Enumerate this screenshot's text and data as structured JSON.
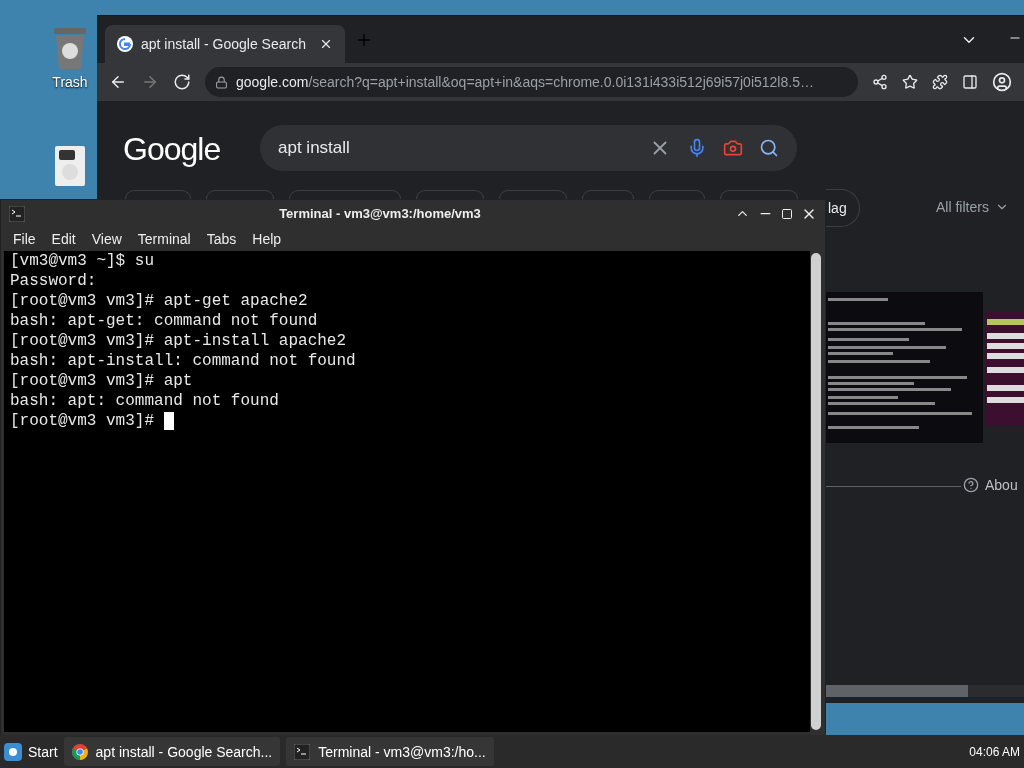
{
  "desktop": {
    "icons": [
      {
        "label": "Trash"
      }
    ]
  },
  "browser": {
    "tab": {
      "title": "apt install - Google Search",
      "selected": true
    },
    "address": {
      "host": "google.com",
      "path": "/search?q=apt+install&oq=apt+in&aqs=chrome.0.0i131i433i512j69i57j0i512l8.5…"
    },
    "logo": "Google",
    "search": {
      "value": "apt install"
    },
    "chip": "lag",
    "all_filters": "All filters",
    "about": "Abou"
  },
  "terminal": {
    "title": "Terminal - vm3@vm3:/home/vm3",
    "menu": [
      "File",
      "Edit",
      "View",
      "Terminal",
      "Tabs",
      "Help"
    ],
    "lines": [
      "[vm3@vm3 ~]$ su",
      "Password:",
      "[root@vm3 vm3]# apt-get apache2",
      "bash: apt-get: command not found",
      "[root@vm3 vm3]# apt-install apache2",
      "bash: apt-install: command not found",
      "[root@vm3 vm3]# apt",
      "bash: apt: command not found",
      "[root@vm3 vm3]# "
    ]
  },
  "taskbar": {
    "start": "Start",
    "items": [
      {
        "kind": "browser",
        "label": "apt install - Google Search...",
        "selected": false
      },
      {
        "kind": "terminal",
        "label": "Terminal - vm3@vm3:/ho...",
        "selected": false
      }
    ],
    "clock": "04:06 AM"
  }
}
